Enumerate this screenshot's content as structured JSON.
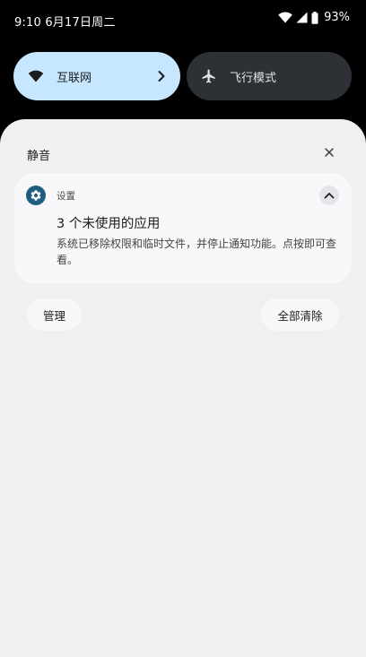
{
  "status_bar": {
    "time_date": "9:10 6月17日周二",
    "battery_percent": "93%",
    "icons": [
      "wifi-icon",
      "cellular-signal-icon",
      "battery-icon"
    ]
  },
  "quick_settings": {
    "internet": {
      "label": "互联网",
      "icon": "wifi-icon",
      "active": true
    },
    "airplane": {
      "label": "飞行模式",
      "icon": "airplane-icon",
      "active": false
    }
  },
  "notifications": {
    "section_title": "静音",
    "card": {
      "app_name": "设置",
      "app_icon": "settings-gear-icon",
      "title": "3 个未使用的应用",
      "body": "系统已移除权限和临时文件，并停止通知功能。点按即可查看。",
      "expanded": true
    },
    "manage_label": "管理",
    "clear_all_label": "全部清除"
  },
  "colors": {
    "internet_tile_bg": "#c6e7ff",
    "airplane_tile_bg": "#2d3135",
    "panel_bg": "#eff0f2",
    "card_bg": "#f8f8fb",
    "app_icon_bg": "#1c5d80"
  }
}
